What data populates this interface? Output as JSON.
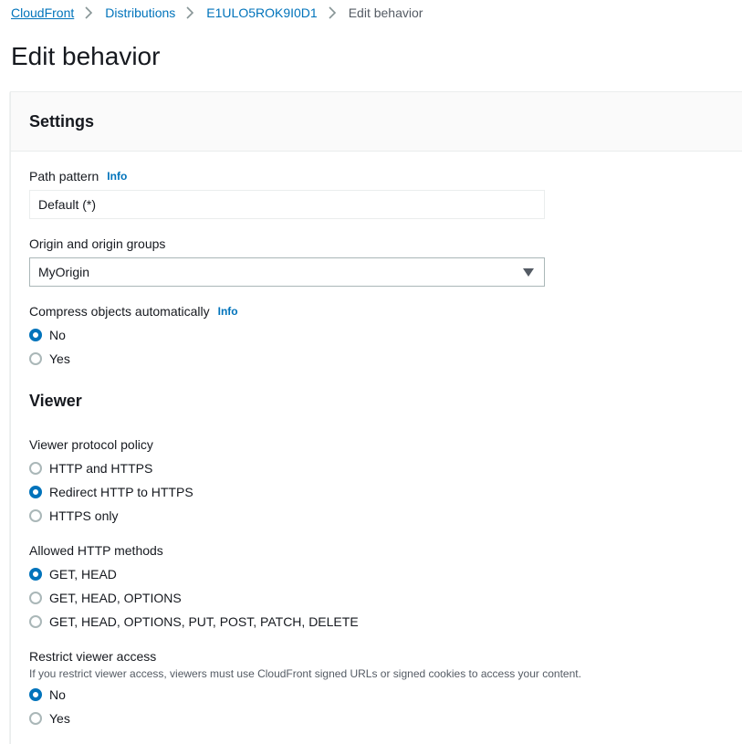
{
  "breadcrumb": {
    "items": [
      "CloudFront",
      "Distributions",
      "E1ULO5ROK9I0D1"
    ],
    "current": "Edit behavior"
  },
  "page": {
    "title": "Edit behavior"
  },
  "settings": {
    "title": "Settings",
    "path_pattern": {
      "label": "Path pattern",
      "info": "Info",
      "value": "Default (*)"
    },
    "origin": {
      "label": "Origin and origin groups",
      "value": "MyOrigin"
    },
    "compress": {
      "label": "Compress objects automatically",
      "info": "Info",
      "options": [
        "No",
        "Yes"
      ],
      "selected": "No"
    }
  },
  "viewer": {
    "title": "Viewer",
    "protocol_policy": {
      "label": "Viewer protocol policy",
      "options": [
        "HTTP and HTTPS",
        "Redirect HTTP to HTTPS",
        "HTTPS only"
      ],
      "selected": "Redirect HTTP to HTTPS"
    },
    "allowed_methods": {
      "label": "Allowed HTTP methods",
      "options": [
        "GET, HEAD",
        "GET, HEAD, OPTIONS",
        "GET, HEAD, OPTIONS, PUT, POST, PATCH, DELETE"
      ],
      "selected": "GET, HEAD"
    },
    "restrict_access": {
      "label": "Restrict viewer access",
      "description": "If you restrict viewer access, viewers must use CloudFront signed URLs or signed cookies to access your content.",
      "options": [
        "No",
        "Yes"
      ],
      "selected": "No"
    }
  },
  "colors": {
    "link": "#0073bb",
    "radio_selected": "#0073bb",
    "text": "#16191f",
    "muted": "#545b64"
  }
}
